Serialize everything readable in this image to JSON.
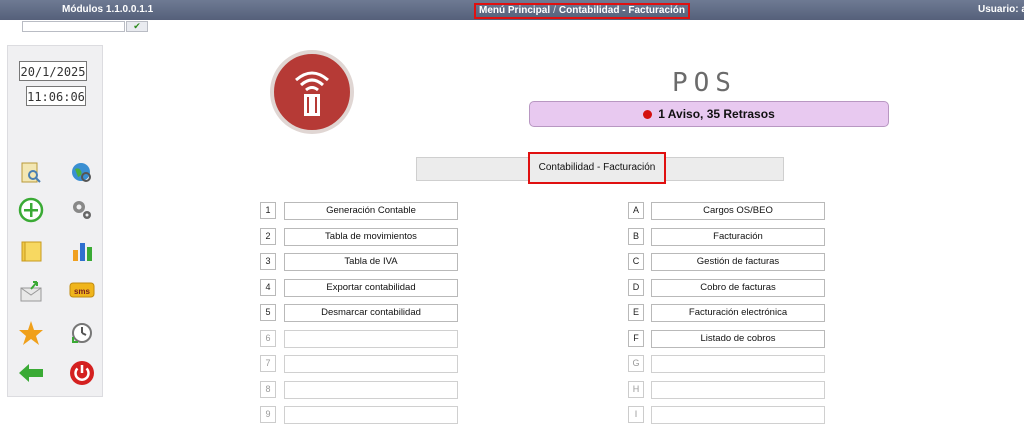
{
  "header": {
    "modules": "Módulos 1.1.0.0.1.1",
    "breadcrumb_main": "Menú Principal",
    "breadcrumb_sep": "/",
    "breadcrumb_current": "Contabilidad - Facturación",
    "user": "Usuario: a"
  },
  "quickbar": {
    "go_icon": "✔"
  },
  "sidebar": {
    "date": "20/1/2025",
    "time": "11:06:06"
  },
  "brand": {
    "title": "POS",
    "alert": "1 Aviso, 35 Retrasos"
  },
  "section_title": "Contabilidad - Facturación",
  "left_menu": [
    {
      "key": "1",
      "label": "Generación Contable"
    },
    {
      "key": "2",
      "label": "Tabla de movimientos"
    },
    {
      "key": "3",
      "label": "Tabla de IVA"
    },
    {
      "key": "4",
      "label": "Exportar contabilidad"
    },
    {
      "key": "5",
      "label": "Desmarcar contabilidad"
    },
    {
      "key": "6",
      "label": ""
    },
    {
      "key": "7",
      "label": ""
    },
    {
      "key": "8",
      "label": ""
    },
    {
      "key": "9",
      "label": ""
    }
  ],
  "right_menu": [
    {
      "key": "A",
      "label": "Cargos OS/BEO"
    },
    {
      "key": "B",
      "label": "Facturación"
    },
    {
      "key": "C",
      "label": "Gestión de facturas"
    },
    {
      "key": "D",
      "label": "Cobro de facturas"
    },
    {
      "key": "E",
      "label": "Facturación electrónica"
    },
    {
      "key": "F",
      "label": "Listado de cobros"
    },
    {
      "key": "G",
      "label": ""
    },
    {
      "key": "H",
      "label": ""
    },
    {
      "key": "I",
      "label": ""
    }
  ]
}
